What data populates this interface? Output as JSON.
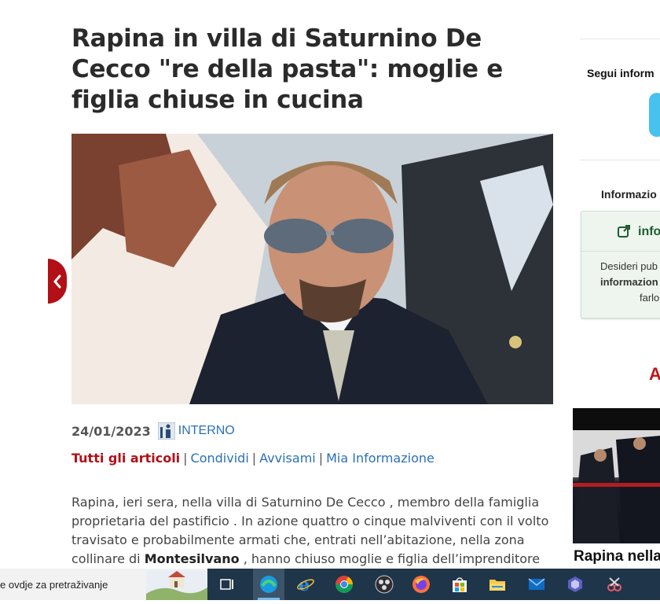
{
  "article": {
    "title": "Rapina in villa di Saturnino De Cecco \"re della pasta\": moglie e figlia chiuse in cucina",
    "date": "24/01/2023",
    "category": "INTERNO",
    "links": {
      "all": "Tutti gli articoli",
      "share": "Condividi",
      "notify": "Avvisami",
      "my_info": "Mia Informazione",
      "separator": "|"
    },
    "body_part1": "Rapina, ieri sera, nella villa di Saturnino De Cecco , membro della famiglia proprietaria del pastificio . In azione quattro o cinque malviventi con il volto travisato e probabilmente armati che, entrati nell’abitazione, nella zona collinare di ",
    "body_bold": "Montesilvano",
    "body_part2": " , hanno chiuso moglie e figlia dell’imprenditore in"
  },
  "sidebar": {
    "follow": "Segui inform",
    "info_heading": "Informazio",
    "box_title": "info",
    "box_text_1": "Desideri pub",
    "box_text_2": "informazion",
    "box_text_3": "farlo",
    "red_letter": "A",
    "headline": "Rapina nella"
  },
  "taskbar": {
    "search_text": "e ovdje za pretraživanje",
    "icons": [
      "task-view-icon",
      "edge-icon",
      "ie-icon",
      "chrome-icon",
      "obs-icon",
      "firefox-icon",
      "store-icon",
      "file-explorer-icon",
      "mail-icon",
      "teams-icon",
      "snipping-icon"
    ]
  },
  "colors": {
    "accent": "#b30f17",
    "link": "#2a70b8",
    "taskbar": "#1f3549"
  }
}
